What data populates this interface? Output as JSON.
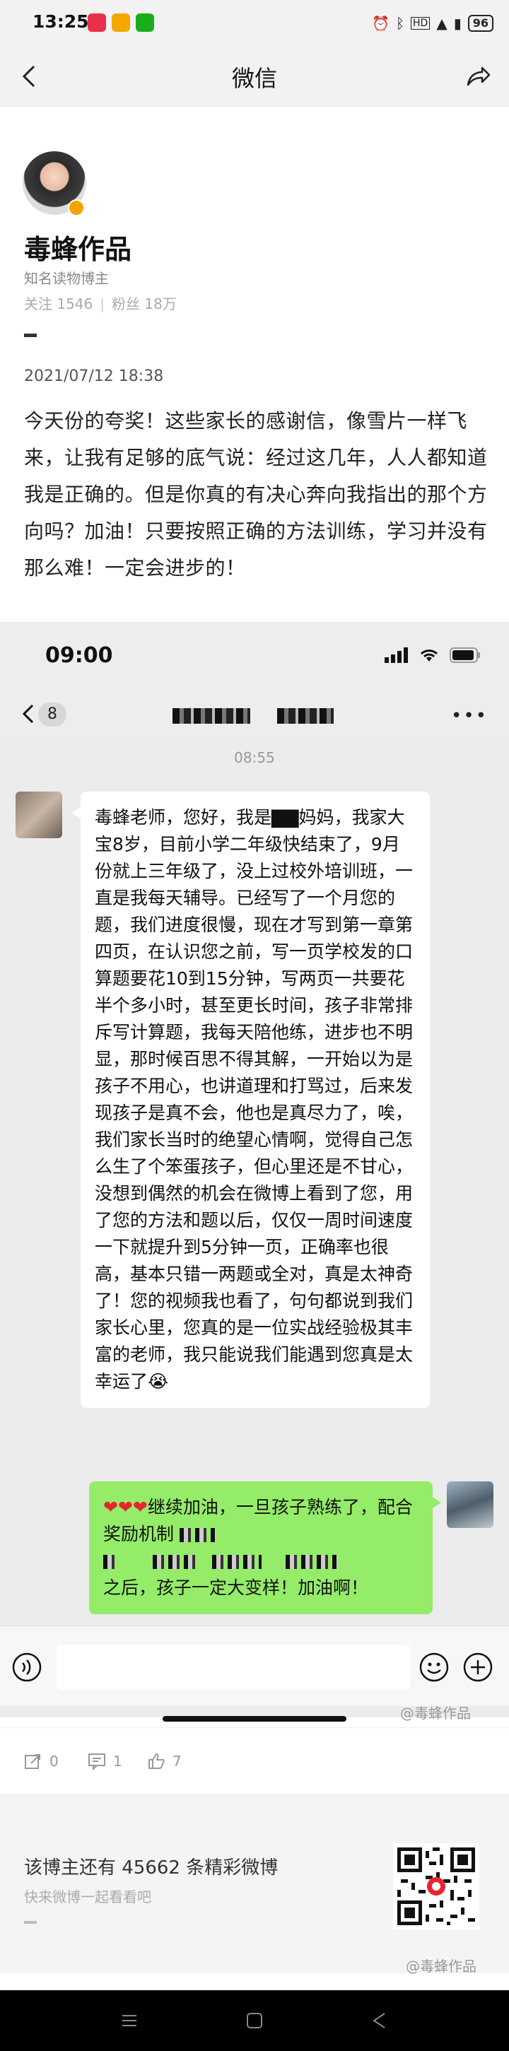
{
  "status_bar": {
    "time": "13:25",
    "battery": "96"
  },
  "nav": {
    "title": "微信"
  },
  "post": {
    "author": "毒蜂作品",
    "role": "知名读物博主",
    "followers_label": "关注 1546",
    "fans_label": "粉丝 18万",
    "date": "2021/07/12 18:38",
    "text": "今天份的夸奖！这些家长的感谢信，像雪片一样飞来，让我有足够的底气说：经过这几年，人人都知道我是正确的。但是你真的有决心奔向我指出的那个方向吗？加油！只要按照正确的方法训练，学习并没有那么难！一定会进步的！"
  },
  "chat": {
    "time": "09:00",
    "unread": "8",
    "message_time": "08:55",
    "left_message": "毒蜂老师，您好，我是▇▇妈妈，我家大宝8岁，目前小学二年级快结束了，9月份就上三年级了，没上过校外培训班，一直是我每天辅导。已经写了一个月您的题，我们进度很慢，现在才写到第一章第四页，在认识您之前，写一页学校发的口算题要花10到15分钟，写两页一共要花半个多小时，甚至更长时间，孩子非常排斥写计算题，我每天陪他练，进步也不明显，那时候百思不得其解，一开始以为是孩子不用心，也讲道理和打骂过，后来发现孩子是真不会，他也是真尽力了，唉，我们家长当时的绝望心情啊，觉得自己怎么生了个笨蛋孩子，但心里还是不甘心，没想到偶然的机会在微博上看到了您，用了您的方法和题以后，仅仅一周时间速度一下就提升到5分钟一页，正确率也很高，基本只错一两题或全对，真是太神奇了！您的视频我也看了，句句都说到我们家长心里，您真的是一位实战经验极其丰富的老师，我只能说我们能遇到您真是太幸运了😭",
    "right_hearts": "❤❤❤",
    "right_message_part1": "继续加油，一旦孩子熟练了，配合奖励机制",
    "right_message_part2": "之后，孩子一定大变样！加油啊！"
  },
  "watermark": "@毒蜂作品",
  "actions": {
    "share_count": "0",
    "comment_count": "1",
    "like_count": "7"
  },
  "promo": {
    "title": "该博主还有 45662 条精彩微博",
    "subtitle": "快来微博一起看看吧"
  },
  "colors": {
    "bubble_green": "#95ec69",
    "chat_bg": "#ececec",
    "verified_badge": "#f5a300"
  }
}
